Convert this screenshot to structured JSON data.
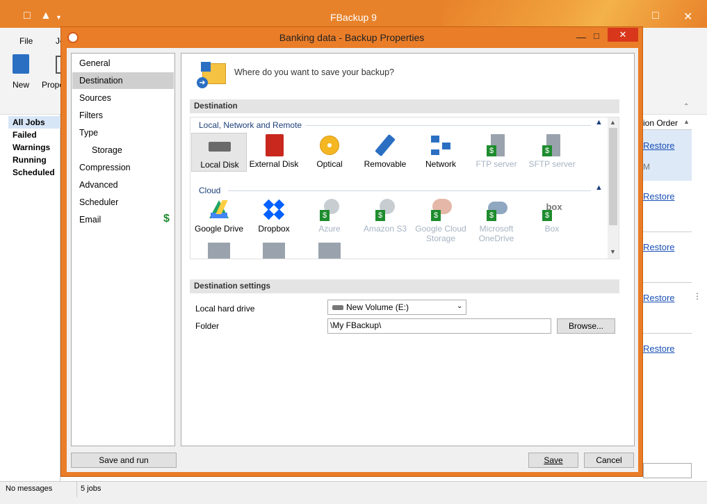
{
  "app": {
    "title": "FBackup 9",
    "tabs": [
      "File",
      "Jo"
    ],
    "ribbon": {
      "new_label": "New",
      "properties_label": "Prope"
    },
    "nav": [
      "All Jobs",
      "Failed",
      "Warnings",
      "Running",
      "Scheduled"
    ],
    "status": {
      "messages": "No messages",
      "jobs": "5 jobs"
    },
    "right": {
      "column_header": "ion Order",
      "restore_label": "Restore",
      "partial_label": "M"
    }
  },
  "dialog": {
    "title": "Banking data - Backup Properties",
    "close_glyph": "✕",
    "pages": [
      "General",
      "Destination",
      "Sources",
      "Filters",
      "Type",
      "Storage",
      "Compression",
      "Advanced",
      "Scheduler",
      "Email"
    ],
    "email_badge": "$",
    "question": "Where do you want to save your backup?",
    "destination_header": "Destination",
    "groups": {
      "local": "Local, Network and Remote",
      "cloud": "Cloud"
    },
    "local_items": [
      "Local Disk",
      "External Disk",
      "Optical",
      "Removable",
      "Network",
      "FTP server",
      "SFTP server"
    ],
    "cloud_items": [
      "Google Drive",
      "Dropbox",
      "Azure",
      "Amazon S3",
      "Google Cloud Storage",
      "Microsoft OneDrive",
      "Box"
    ],
    "settings_header": "Destination settings",
    "local_drive_label": "Local hard drive",
    "local_drive_value": "New Volume (E:)",
    "folder_label": "Folder",
    "folder_value": "\\My FBackup\\",
    "browse_label": "Browse...",
    "save_run_label": "Save and run",
    "save_label": "Save",
    "cancel_label": "Cancel"
  },
  "colors": {
    "accent": "#e8822a",
    "link": "#1a4fb4",
    "group": "#1d3f7a"
  }
}
